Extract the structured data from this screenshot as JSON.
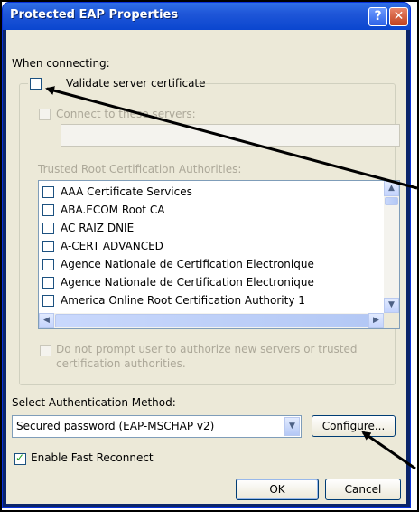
{
  "window": {
    "title": "Protected EAP Properties"
  },
  "titlebar": {
    "help_glyph": "?",
    "close_glyph": "✕"
  },
  "when_connecting": "When connecting:",
  "validate_cert": {
    "label": "Validate server certificate",
    "checked": false
  },
  "connect_servers": {
    "label": "Connect to these servers:",
    "value": ""
  },
  "trusted_root": {
    "label": "Trusted Root Certification Authorities:",
    "items": [
      "AAA Certificate Services",
      "ABA.ECOM Root CA",
      "AC RAIZ DNIE",
      "A-CERT ADVANCED",
      "Agence Nationale de Certification Electronique",
      "Agence Nationale de Certification Electronique",
      "America Online Root Certification Authority 1"
    ]
  },
  "do_not_prompt": {
    "line1": "Do not prompt user to authorize new servers or trusted",
    "line2": "certification authorities."
  },
  "auth_method": {
    "label": "Select Authentication Method:",
    "selected": "Secured password (EAP-MSCHAP v2)",
    "configure_label": "Configure..."
  },
  "fast_reconnect": {
    "label": "Enable Fast Reconnect",
    "checked": true
  },
  "buttons": {
    "ok": "OK",
    "cancel": "Cancel"
  },
  "colors": {
    "titlebar": "#0a46cf",
    "dialog_bg": "#ece9d8",
    "disabled_text": "#aca899",
    "annotation_arrow": "#000000"
  }
}
